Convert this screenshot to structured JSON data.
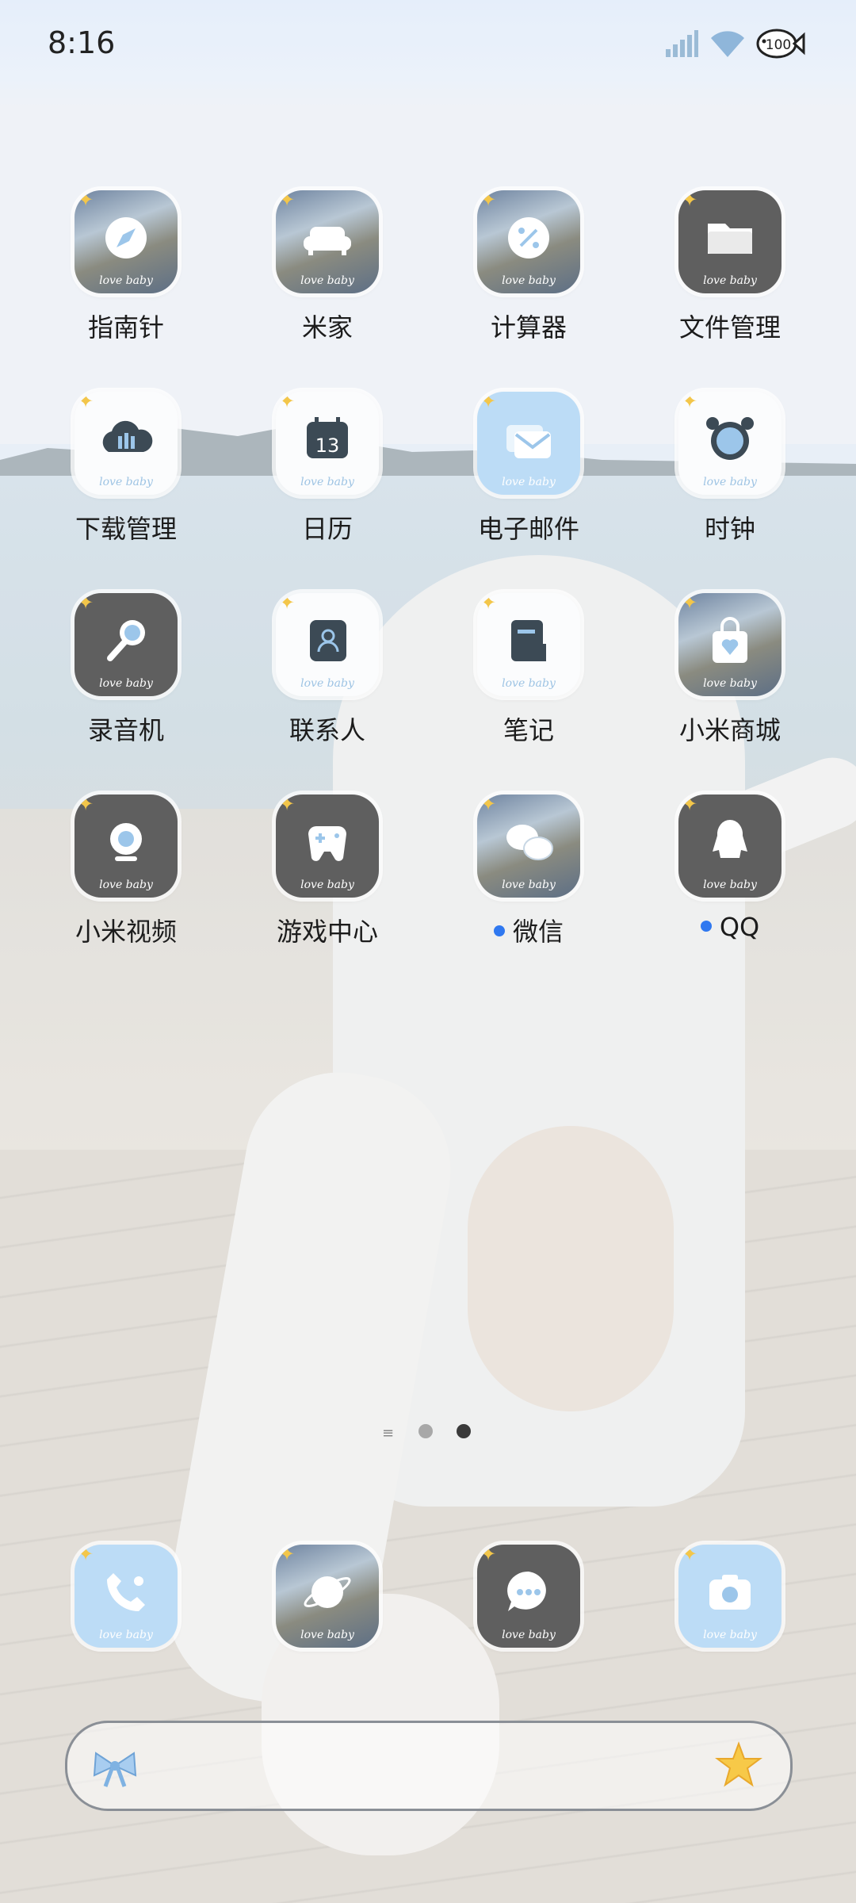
{
  "status_bar": {
    "time": "8:16",
    "battery": "100"
  },
  "apps": [
    {
      "label": "指南针",
      "icon": "compass-icon",
      "style": "photo",
      "badge": false
    },
    {
      "label": "米家",
      "icon": "sofa-icon",
      "style": "photo",
      "badge": false
    },
    {
      "label": "计算器",
      "icon": "calculator-icon",
      "style": "photo",
      "badge": false
    },
    {
      "label": "文件管理",
      "icon": "folder-icon",
      "style": "dark",
      "badge": false
    },
    {
      "label": "下载管理",
      "icon": "download-cloud-icon",
      "style": "white",
      "badge": false
    },
    {
      "label": "日历",
      "icon": "calendar-icon",
      "style": "white",
      "badge": false,
      "glyph_text": "13"
    },
    {
      "label": "电子邮件",
      "icon": "mail-icon",
      "style": "blue",
      "badge": false
    },
    {
      "label": "时钟",
      "icon": "alarm-clock-icon",
      "style": "white",
      "badge": false
    },
    {
      "label": "录音机",
      "icon": "microphone-icon",
      "style": "dark",
      "badge": false
    },
    {
      "label": "联系人",
      "icon": "contacts-icon",
      "style": "white",
      "badge": false
    },
    {
      "label": "笔记",
      "icon": "notes-icon",
      "style": "white",
      "badge": false
    },
    {
      "label": "小米商城",
      "icon": "shopping-bag-icon",
      "style": "photo",
      "badge": false
    },
    {
      "label": "小米视频",
      "icon": "video-camera-icon",
      "style": "dark",
      "badge": false
    },
    {
      "label": "游戏中心",
      "icon": "gamepad-icon",
      "style": "dark",
      "badge": false
    },
    {
      "label": "微信",
      "icon": "wechat-icon",
      "style": "photo",
      "badge": true
    },
    {
      "label": "QQ",
      "icon": "qq-penguin-icon",
      "style": "dark",
      "badge": true
    }
  ],
  "icon_caption": "love baby",
  "dock": [
    {
      "icon": "phone-icon",
      "style": "blue"
    },
    {
      "icon": "browser-planet-icon",
      "style": "photo"
    },
    {
      "icon": "messages-icon",
      "style": "dark"
    },
    {
      "icon": "camera-icon",
      "style": "blue"
    }
  ],
  "pager": {
    "pages": 2,
    "current": 2
  },
  "colors": {
    "accent_blue": "#2f78f0",
    "icon_dark": "#5f5f5f",
    "icon_blue": "#bcdcf6",
    "sparkle": "#f3c64a"
  }
}
